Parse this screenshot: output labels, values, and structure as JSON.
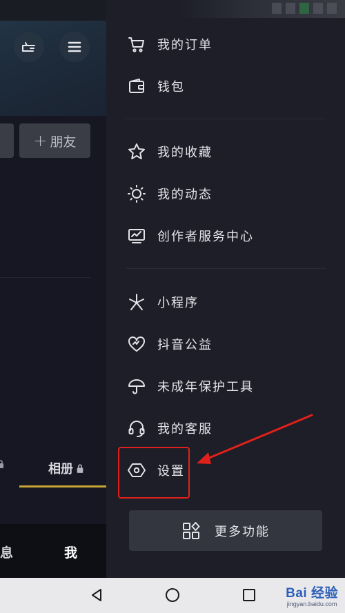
{
  "left_pane": {
    "add_friend_label": "朋友",
    "add_friend_plus": "+",
    "tab_album_label": "相册",
    "nav_partial_messages": "息",
    "nav_me": "我"
  },
  "drawer": {
    "items": [
      {
        "label": "我的订单",
        "icon": "cart-icon"
      },
      {
        "label": "钱包",
        "icon": "wallet-icon"
      },
      {
        "label": "我的收藏",
        "icon": "star-icon"
      },
      {
        "label": "我的动态",
        "icon": "sun-icon"
      },
      {
        "label": "创作者服务中心",
        "icon": "creator-monitor-icon"
      },
      {
        "label": "小程序",
        "icon": "mini-program-icon"
      },
      {
        "label": "抖音公益",
        "icon": "charity-heart-icon"
      },
      {
        "label": "未成年保护工具",
        "icon": "umbrella-icon"
      },
      {
        "label": "我的客服",
        "icon": "headset-icon"
      },
      {
        "label": "设置",
        "icon": "hexagon-settings-icon"
      }
    ],
    "more_button_label": "更多功能"
  },
  "annotation": {
    "highlight_color": "#e0211b"
  },
  "system_nav": {
    "watermark_main": "Bai 经验",
    "watermark_sub": "jingyan.baidu.com"
  },
  "colors": {
    "drawer_bg": "#1d1e27",
    "left_bg": "#161722",
    "tab_accent": "#c9a633",
    "text": "#e4e5ea"
  }
}
